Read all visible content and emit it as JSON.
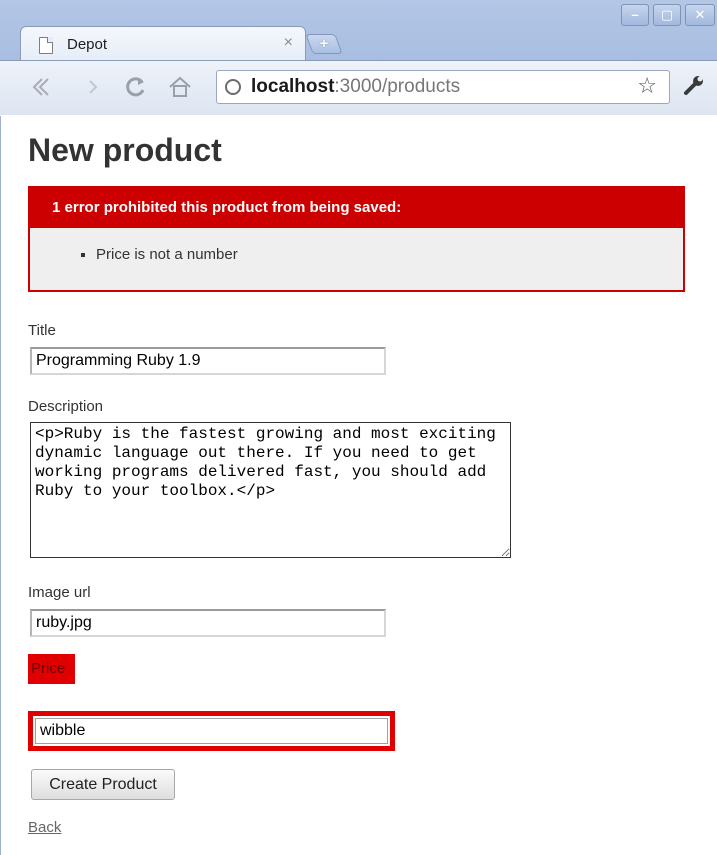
{
  "browser": {
    "tab_title": "Depot",
    "tab_close": "×",
    "new_tab": "+",
    "window_controls": {
      "minimize": "–",
      "maximize": "▢",
      "close": "✕"
    },
    "url_host": "localhost",
    "url_rest": ":3000/products",
    "icons": [
      "page-icon",
      "back-icon",
      "forward-icon",
      "reload-icon",
      "home-icon",
      "globe-icon",
      "star-icon",
      "wrench-icon"
    ]
  },
  "page": {
    "heading": "New product",
    "error": {
      "title": "1 error prohibited this product from being saved:",
      "items": [
        "Price is not a number"
      ]
    },
    "form": {
      "title_label": "Title",
      "title_value": "Programming Ruby 1.9",
      "description_label": "Description",
      "description_value": "<p>Ruby is the fastest growing and most exciting dynamic language out there. If you need to get working programs delivered fast, you should add Ruby to your toolbox.</p>",
      "image_label": "Image url",
      "image_value": "ruby.jpg",
      "price_label": "Price",
      "price_value": "wibble",
      "submit_label": "Create Product"
    },
    "back_link": "Back"
  },
  "colors": {
    "error_red": "#cc0000",
    "field_error_red": "#e00000",
    "text": "#333333"
  }
}
